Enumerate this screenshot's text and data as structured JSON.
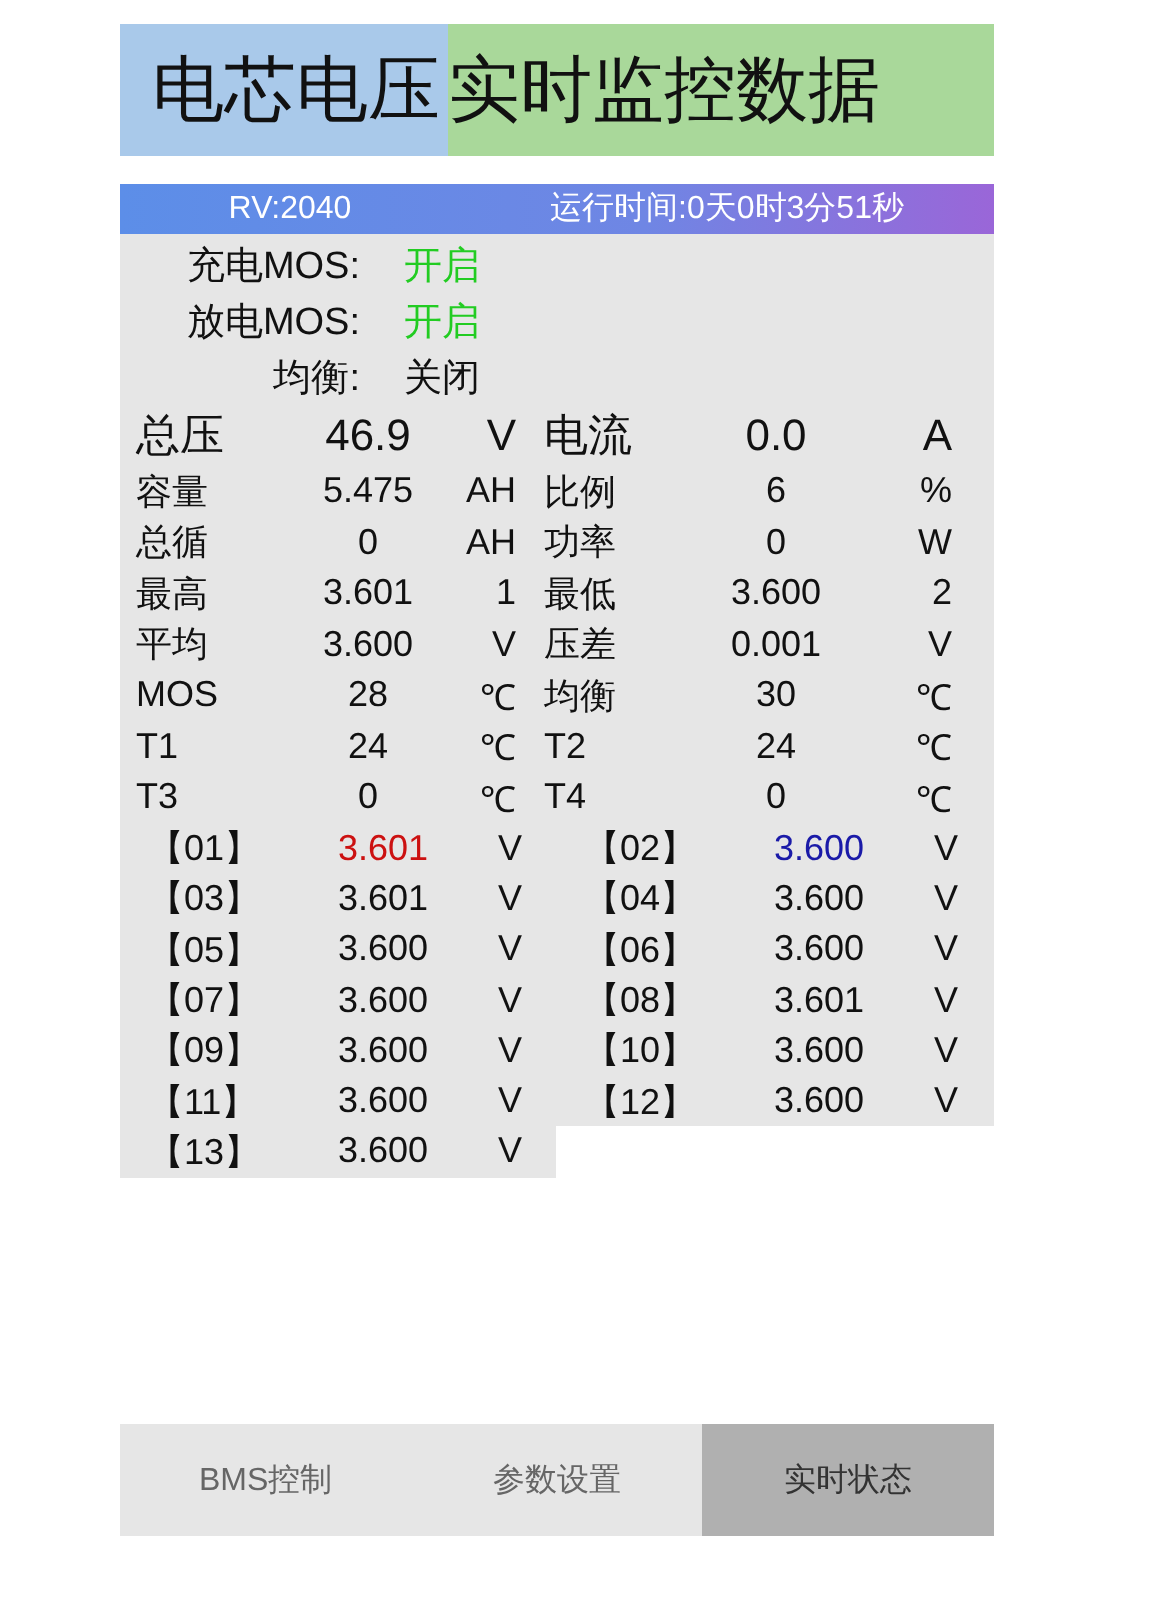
{
  "banner": [
    {
      "text": "电芯电压",
      "color": "#a9c9ea"
    },
    {
      "text": "实时监控数据",
      "color": "#a9d89a"
    }
  ],
  "header": {
    "version": "RV:2040",
    "runtime": "运行时间:0天0时3分51秒"
  },
  "switches": [
    {
      "label": "充电MOS:",
      "value": "开启",
      "on": true
    },
    {
      "label": "放电MOS:",
      "value": "开启",
      "on": true
    },
    {
      "label": "均衡:",
      "value": "关闭",
      "on": false
    }
  ],
  "stats": [
    [
      {
        "label": "总压",
        "value": "46.9",
        "unit": "V"
      },
      {
        "label": "电流",
        "value": "0.0",
        "unit": "A"
      }
    ],
    [
      {
        "label": "容量",
        "value": "5.475",
        "unit": "AH"
      },
      {
        "label": "比例",
        "value": "6",
        "unit": "%"
      }
    ],
    [
      {
        "label": "总循",
        "value": "0",
        "unit": "AH"
      },
      {
        "label": "功率",
        "value": "0",
        "unit": "W"
      }
    ],
    [
      {
        "label": "最高",
        "value": "3.601",
        "unit": "1"
      },
      {
        "label": "最低",
        "value": "3.600",
        "unit": "2"
      }
    ],
    [
      {
        "label": "平均",
        "value": "3.600",
        "unit": "V"
      },
      {
        "label": "压差",
        "value": "0.001",
        "unit": "V"
      }
    ],
    [
      {
        "label": "MOS",
        "value": "28",
        "unit": "℃"
      },
      {
        "label": "均衡",
        "value": "30",
        "unit": "℃"
      }
    ],
    [
      {
        "label": "T1",
        "value": "24",
        "unit": "℃"
      },
      {
        "label": "T2",
        "value": "24",
        "unit": "℃"
      }
    ],
    [
      {
        "label": "T3",
        "value": "0",
        "unit": "℃"
      },
      {
        "label": "T4",
        "value": "0",
        "unit": "℃"
      }
    ]
  ],
  "cells": [
    {
      "label": "【01】",
      "value": "3.601",
      "unit": "V",
      "color": "#cc1111"
    },
    {
      "label": "【02】",
      "value": "3.600",
      "unit": "V",
      "color": "#1a1aa8"
    },
    {
      "label": "【03】",
      "value": "3.601",
      "unit": "V",
      "color": "#111111"
    },
    {
      "label": "【04】",
      "value": "3.600",
      "unit": "V",
      "color": "#111111"
    },
    {
      "label": "【05】",
      "value": "3.600",
      "unit": "V",
      "color": "#111111"
    },
    {
      "label": "【06】",
      "value": "3.600",
      "unit": "V",
      "color": "#111111"
    },
    {
      "label": "【07】",
      "value": "3.600",
      "unit": "V",
      "color": "#111111"
    },
    {
      "label": "【08】",
      "value": "3.601",
      "unit": "V",
      "color": "#111111"
    },
    {
      "label": "【09】",
      "value": "3.600",
      "unit": "V",
      "color": "#111111"
    },
    {
      "label": "【10】",
      "value": "3.600",
      "unit": "V",
      "color": "#111111"
    },
    {
      "label": "【11】",
      "value": "3.600",
      "unit": "V",
      "color": "#111111"
    },
    {
      "label": "【12】",
      "value": "3.600",
      "unit": "V",
      "color": "#111111"
    },
    {
      "label": "【13】",
      "value": "3.600",
      "unit": "V",
      "color": "#111111"
    }
  ],
  "tabs": [
    {
      "label": "BMS控制",
      "selected": false
    },
    {
      "label": "参数设置",
      "selected": false
    },
    {
      "label": "实时状态",
      "selected": true
    }
  ]
}
